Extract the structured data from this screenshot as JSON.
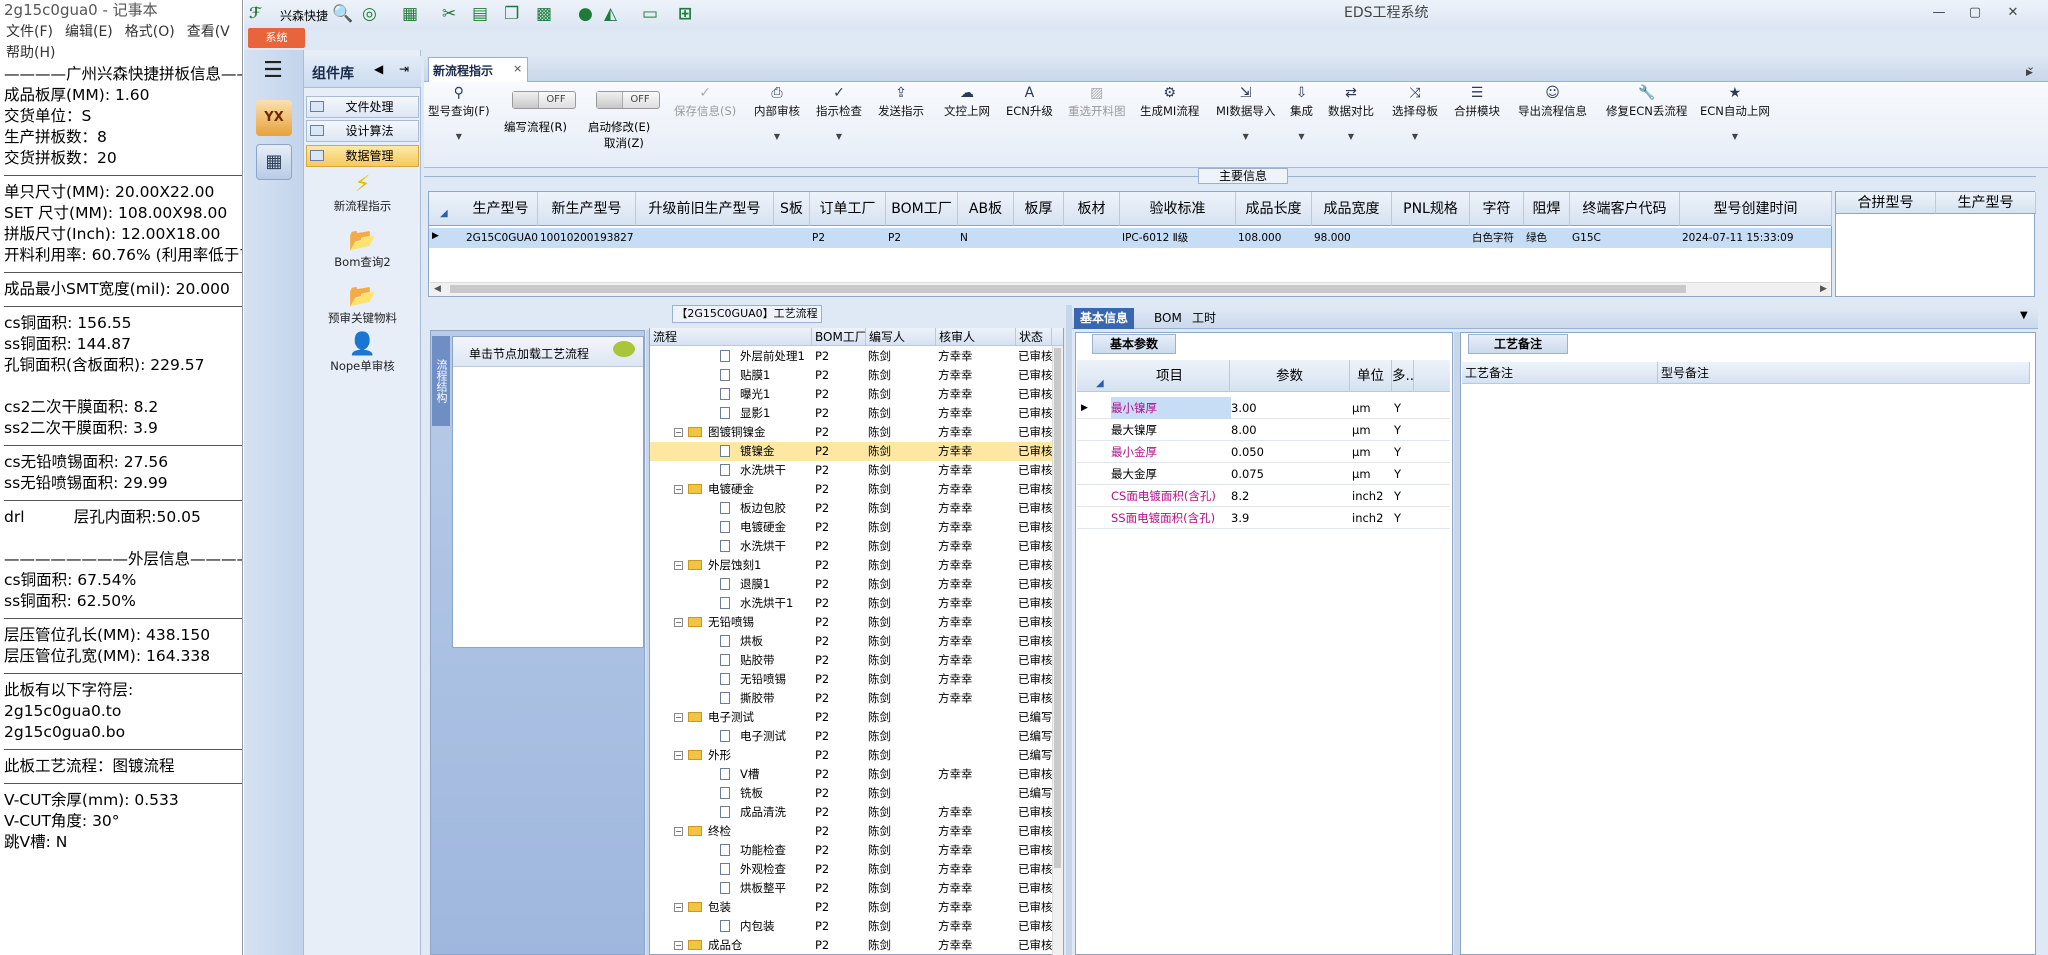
{
  "notepad": {
    "title": "2g15c0gua0 - 记事本",
    "menu": [
      "文件(F)",
      "编辑(E)",
      "格式(O)",
      "查看(V",
      "帮助(H)"
    ],
    "lines": [
      "————广州兴森快捷拼板信息————",
      "成品板厚(MM): 1.60",
      "交货单位：S",
      "生产拼板数：8",
      "交货拼板数：20",
      "SEP",
      "单只尺寸(MM): 20.00X22.00",
      "SET 尺寸(MM): 108.00X98.00",
      "拼版尺寸(Inch): 12.00X18.00",
      "开料利用率: 60.76% (利用率低于7",
      "SEP",
      "成品最小SMT宽度(mil): 20.000",
      "SEP",
      "cs铜面积: 156.55",
      "ss铜面积: 144.87",
      "孔铜面积(含板面积): 229.57",
      "",
      "cs2二次干膜面积: 8.2",
      "ss2二次干膜面积: 3.9",
      "SEP",
      "cs无铅喷锡面积: 27.56",
      "ss无铅喷锡面积: 29.99",
      "SEP",
      "drl          层孔内面积:50.05",
      "",
      "————————外层信息————————",
      "cs铜面积: 67.54%",
      "ss铜面积: 62.50%",
      "SEP",
      "层压管位孔长(MM): 438.150",
      "层压管位孔宽(MM): 164.338",
      "SEP",
      "此板有以下字符层:",
      "2g15c0gua0.to",
      "2g15c0gua0.bo",
      "SEP",
      "此板工艺流程：图镀流程",
      "SEP",
      "V-CUT余厚(mm): 0.533",
      "V-CUT角度: 30°",
      "跳V槽: N"
    ]
  },
  "app": {
    "brand": "兴森快捷",
    "title": "EDS工程系统",
    "system_tab": "系统",
    "toolbar_icons": [
      "search-icon",
      "lifebuoy-icon",
      "table-icon",
      "scissors-icon",
      "film-icon",
      "copy-icon",
      "grid-icon",
      "user-icon",
      "chart-icon",
      "monitor-icon",
      "windows-icon"
    ]
  },
  "sidebar": {
    "header": "组件库",
    "items": [
      "文件处理",
      "设计算法",
      "数据管理"
    ],
    "big_items": [
      "新流程指示",
      "Bom查询2",
      "预审关键物料",
      "Nope单审核"
    ]
  },
  "tab": {
    "label": "新流程指示"
  },
  "toolbar": {
    "buttons": [
      {
        "label": "型号查询(F)",
        "icon": "search-icon"
      },
      {
        "label": "编写流程(R)",
        "icon": "toggle"
      },
      {
        "label": "启动修改(E)",
        "icon": "toggle"
      },
      {
        "label": "取消(Z)",
        "icon": ""
      },
      {
        "label": "保存信息(S)",
        "icon": "check-icon"
      },
      {
        "label": "内部审核",
        "icon": "printer-icon"
      },
      {
        "label": "指示检查",
        "icon": "check-icon"
      },
      {
        "label": "发送指示",
        "icon": "upload-icon"
      },
      {
        "label": "文控上网",
        "icon": "cloud-upload-icon"
      },
      {
        "label": "ECN升级",
        "icon": "text-icon"
      },
      {
        "label": "重选开料图",
        "icon": "image-icon"
      },
      {
        "label": "生成MI流程",
        "icon": "gears-icon"
      },
      {
        "label": "MI数据导入",
        "icon": "import-icon"
      },
      {
        "label": "集成",
        "icon": "download-icon"
      },
      {
        "label": "数据对比",
        "icon": "compare-icon"
      },
      {
        "label": "选择母板",
        "icon": "shuffle-icon"
      },
      {
        "label": "合拼模块",
        "icon": "list-icon"
      },
      {
        "label": "导出流程信息",
        "icon": "smile-icon"
      },
      {
        "label": "修复ECN丢流程",
        "icon": "wrench-icon"
      },
      {
        "label": "ECN自动上网",
        "icon": "star-icon"
      }
    ],
    "toggle_text": "OFF"
  },
  "main_info": {
    "label": "主要信息",
    "columns": [
      "生产型号",
      "新生产型号",
      "升级前旧生产型号",
      "S板",
      "订单工厂",
      "BOM工厂",
      "AB板",
      "板厚",
      "板材",
      "验收标准",
      "成品长度",
      "成品宽度",
      "PNL规格",
      "字符",
      "阻焊",
      "终端客户代码",
      "型号创建时间"
    ],
    "row": [
      "2G15C0GUA0",
      "10010200193827",
      "",
      "",
      "P2",
      "P2",
      "N",
      "",
      "",
      "IPC-6012 Ⅱ级",
      "108.000",
      "98.000",
      "",
      "白色字符",
      "绿色",
      "G15C",
      "2024-07-11 15:33:09"
    ],
    "side_columns": [
      "合拼型号",
      "生产型号"
    ]
  },
  "process": {
    "label": "【2G15C0GUA0】工艺流程",
    "vtab": "流程结构",
    "hint": "单击节点加载工艺流程",
    "columns": [
      "流程",
      "BOM工厂",
      "编写人",
      "核审人",
      "状态"
    ],
    "rows": [
      {
        "name": "外层前处理1",
        "type": "doc",
        "level": 2,
        "bom": "P2",
        "writer": "陈剑",
        "reviewer": "方幸幸",
        "status": "已审核"
      },
      {
        "name": "贴膜1",
        "type": "doc",
        "level": 2,
        "bom": "P2",
        "writer": "陈剑",
        "reviewer": "方幸幸",
        "status": "已审核"
      },
      {
        "name": "曝光1",
        "type": "doc",
        "level": 2,
        "bom": "P2",
        "writer": "陈剑",
        "reviewer": "方幸幸",
        "status": "已审核"
      },
      {
        "name": "显影1",
        "type": "doc",
        "level": 2,
        "bom": "P2",
        "writer": "陈剑",
        "reviewer": "方幸幸",
        "status": "已审核"
      },
      {
        "name": "图镀铜镍金",
        "type": "folder",
        "level": 1,
        "bom": "P2",
        "writer": "陈剑",
        "reviewer": "方幸幸",
        "status": "已审核"
      },
      {
        "name": "镀镍金",
        "type": "doc",
        "level": 2,
        "bom": "P2",
        "writer": "陈剑",
        "reviewer": "方幸幸",
        "status": "已审核",
        "selected": true
      },
      {
        "name": "水洗烘干",
        "type": "doc",
        "level": 2,
        "bom": "P2",
        "writer": "陈剑",
        "reviewer": "方幸幸",
        "status": "已审核"
      },
      {
        "name": "电镀硬金",
        "type": "folder",
        "level": 1,
        "bom": "P2",
        "writer": "陈剑",
        "reviewer": "方幸幸",
        "status": "已审核"
      },
      {
        "name": "板边包胶",
        "type": "doc",
        "level": 2,
        "bom": "P2",
        "writer": "陈剑",
        "reviewer": "方幸幸",
        "status": "已审核"
      },
      {
        "name": "电镀硬金",
        "type": "doc",
        "level": 2,
        "bom": "P2",
        "writer": "陈剑",
        "reviewer": "方幸幸",
        "status": "已审核"
      },
      {
        "name": "水洗烘干",
        "type": "doc",
        "level": 2,
        "bom": "P2",
        "writer": "陈剑",
        "reviewer": "方幸幸",
        "status": "已审核"
      },
      {
        "name": "外层蚀刻1",
        "type": "folder",
        "level": 1,
        "bom": "P2",
        "writer": "陈剑",
        "reviewer": "方幸幸",
        "status": "已审核"
      },
      {
        "name": "退膜1",
        "type": "doc",
        "level": 2,
        "bom": "P2",
        "writer": "陈剑",
        "reviewer": "方幸幸",
        "status": "已审核"
      },
      {
        "name": "水洗烘干1",
        "type": "doc",
        "level": 2,
        "bom": "P2",
        "writer": "陈剑",
        "reviewer": "方幸幸",
        "status": "已审核"
      },
      {
        "name": "无铅喷锡",
        "type": "folder",
        "level": 1,
        "bom": "P2",
        "writer": "陈剑",
        "reviewer": "方幸幸",
        "status": "已审核"
      },
      {
        "name": "烘板",
        "type": "doc",
        "level": 2,
        "bom": "P2",
        "writer": "陈剑",
        "reviewer": "方幸幸",
        "status": "已审核"
      },
      {
        "name": "贴胶带",
        "type": "doc",
        "level": 2,
        "bom": "P2",
        "writer": "陈剑",
        "reviewer": "方幸幸",
        "status": "已审核"
      },
      {
        "name": "无铅喷锡",
        "type": "doc",
        "level": 2,
        "bom": "P2",
        "writer": "陈剑",
        "reviewer": "方幸幸",
        "status": "已审核"
      },
      {
        "name": "撕胶带",
        "type": "doc",
        "level": 2,
        "bom": "P2",
        "writer": "陈剑",
        "reviewer": "方幸幸",
        "status": "已审核"
      },
      {
        "name": "电子测试",
        "type": "folder",
        "level": 1,
        "bom": "P2",
        "writer": "陈剑",
        "reviewer": "",
        "status": "已编写"
      },
      {
        "name": "电子测试",
        "type": "doc",
        "level": 2,
        "bom": "P2",
        "writer": "陈剑",
        "reviewer": "",
        "status": "已编写"
      },
      {
        "name": "外形",
        "type": "folder",
        "level": 1,
        "bom": "P2",
        "writer": "陈剑",
        "reviewer": "",
        "status": "已编写"
      },
      {
        "name": "V槽",
        "type": "doc",
        "level": 2,
        "bom": "P2",
        "writer": "陈剑",
        "reviewer": "方幸幸",
        "status": "已审核"
      },
      {
        "name": "铣板",
        "type": "doc",
        "level": 2,
        "bom": "P2",
        "writer": "陈剑",
        "reviewer": "",
        "status": "已编写"
      },
      {
        "name": "成品清洗",
        "type": "doc",
        "level": 2,
        "bom": "P2",
        "writer": "陈剑",
        "reviewer": "方幸幸",
        "status": "已审核"
      },
      {
        "name": "终检",
        "type": "folder",
        "level": 1,
        "bom": "P2",
        "writer": "陈剑",
        "reviewer": "方幸幸",
        "status": "已审核"
      },
      {
        "name": "功能检查",
        "type": "doc",
        "level": 2,
        "bom": "P2",
        "writer": "陈剑",
        "reviewer": "方幸幸",
        "status": "已审核"
      },
      {
        "name": "外观检查",
        "type": "doc",
        "level": 2,
        "bom": "P2",
        "writer": "陈剑",
        "reviewer": "方幸幸",
        "status": "已审核"
      },
      {
        "name": "烘板整平",
        "type": "doc",
        "level": 2,
        "bom": "P2",
        "writer": "陈剑",
        "reviewer": "方幸幸",
        "status": "已审核"
      },
      {
        "name": "包装",
        "type": "folder",
        "level": 1,
        "bom": "P2",
        "writer": "陈剑",
        "reviewer": "方幸幸",
        "status": "已审核"
      },
      {
        "name": "内包装",
        "type": "doc",
        "level": 2,
        "bom": "P2",
        "writer": "陈剑",
        "reviewer": "方幸幸",
        "status": "已审核"
      },
      {
        "name": "成品仓",
        "type": "folder",
        "level": 1,
        "bom": "P2",
        "writer": "陈剑",
        "reviewer": "方幸幸",
        "status": "已审核"
      }
    ]
  },
  "right": {
    "tabs": [
      "基本信息",
      "BOM",
      "工时"
    ],
    "basic_params_label": "基本参数",
    "param_columns": [
      "项目",
      "参数",
      "单位",
      "多..."
    ],
    "params": [
      {
        "item": "最小镍厚",
        "value": "3.00",
        "unit": "μm",
        "flag": "Y",
        "color": "#b0108c"
      },
      {
        "item": "最大镍厚",
        "value": "8.00",
        "unit": "μm",
        "flag": "Y",
        "color": "#000000"
      },
      {
        "item": "最小金厚",
        "value": "0.050",
        "unit": "μm",
        "flag": "Y",
        "color": "#b0108c"
      },
      {
        "item": "最大金厚",
        "value": "0.075",
        "unit": "μm",
        "flag": "Y",
        "color": "#000000"
      },
      {
        "item": "CS面电镀面积(含孔)",
        "value": "8.2",
        "unit": "inch2",
        "flag": "Y",
        "color": "#b0108c"
      },
      {
        "item": "SS面电镀面积(含孔)",
        "value": "3.9",
        "unit": "inch2",
        "flag": "Y",
        "color": "#b0108c"
      }
    ],
    "remark_label": "工艺备注",
    "remark_columns": [
      "工艺备注",
      "型号备注"
    ]
  }
}
